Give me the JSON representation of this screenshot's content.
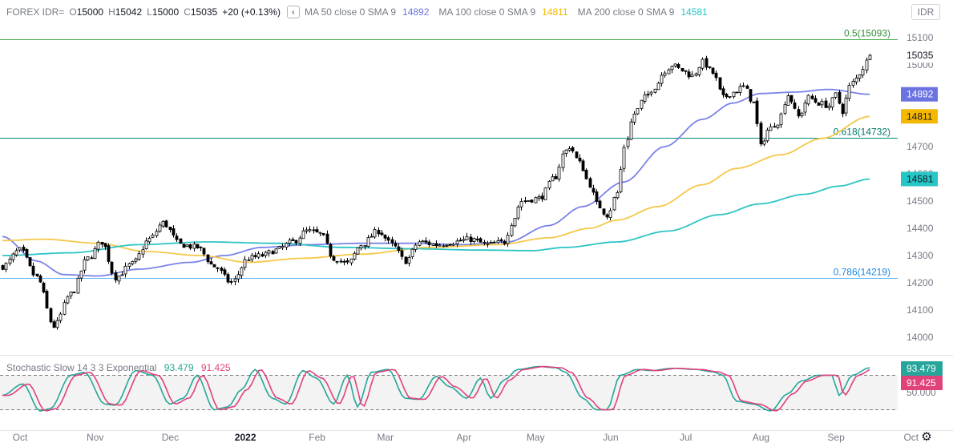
{
  "legend": {
    "symbol": "FOREX IDR=",
    "o_label": "O",
    "o_value": "15000",
    "h_label": "H",
    "h_value": "15042",
    "l_label": "L",
    "l_value": "15000",
    "c_label": "C",
    "c_value": "15035",
    "change": "+20 (+0.13%)",
    "collapse_icon": "chevron-left-icon",
    "ma": [
      {
        "label": "MA 50 close 0 SMA 9",
        "value": "14892",
        "color": "#7b83e8"
      },
      {
        "label": "MA 100 close 0 SMA 9",
        "value": "14811",
        "color": "#f5b800"
      },
      {
        "label": "MA 200 close 0 SMA 9",
        "value": "14581",
        "color": "#26c6c6"
      }
    ]
  },
  "currency_button": "IDR",
  "oscillator": {
    "label": "Stochastic Slow 14 3 3 Exponential",
    "k_value": "93.479",
    "k_color": "#26a69a",
    "d_value": "91.425",
    "d_color": "#e0427a",
    "axis_label": "50.000",
    "band_upper": 80,
    "band_lower": 20
  },
  "price_badges": [
    {
      "text": "15035",
      "value": 15035,
      "style": "plain"
    },
    {
      "text": "14892",
      "value": 14892,
      "bg": "#6b73e0",
      "fg": "#ffffff"
    },
    {
      "text": "14811",
      "value": 14811,
      "bg": "#f5b800",
      "fg": "#131722"
    },
    {
      "text": "14581",
      "value": 14581,
      "bg": "#26c6c6",
      "fg": "#131722"
    }
  ],
  "osc_badges": [
    {
      "text": "93.479",
      "bg": "#26a69a",
      "fg": "#ffffff"
    },
    {
      "text": "91.425",
      "bg": "#e0427a",
      "fg": "#ffffff"
    }
  ],
  "settings_icon": "gear-icon",
  "chart_data": {
    "type": "candlestick",
    "y_range": [
      13950,
      15150
    ],
    "y_ticks": [
      14000,
      14100,
      14200,
      14300,
      14400,
      14500,
      14600,
      14700,
      14800,
      14900,
      15000,
      15100
    ],
    "x_labels": [
      "Oct",
      "Nov",
      "Dec",
      "2022",
      "Feb",
      "Mar",
      "Apr",
      "May",
      "Jun",
      "Jul",
      "Aug",
      "Sep",
      "Oct"
    ],
    "x_month_starts": [
      0,
      22,
      44,
      66,
      87,
      107,
      130,
      151,
      173,
      195,
      217,
      239,
      261
    ],
    "fib_levels": [
      {
        "label": "0.5(15093)",
        "value": 15093,
        "color": "#4caf50",
        "text_color": "#388e3c"
      },
      {
        "label": "0.618(14732)",
        "value": 14732,
        "color": "#00897b",
        "text_color": "#00796b"
      },
      {
        "label": "0.786(14219)",
        "value": 14219,
        "color": "#64b5f6",
        "text_color": "#1e88e5"
      }
    ],
    "last_close": 15035,
    "price_anchors": [
      [
        0,
        14260
      ],
      [
        5,
        14320
      ],
      [
        10,
        14220
      ],
      [
        15,
        14040
      ],
      [
        20,
        14160
      ],
      [
        25,
        14290
      ],
      [
        29,
        14350
      ],
      [
        33,
        14220
      ],
      [
        38,
        14270
      ],
      [
        43,
        14360
      ],
      [
        47,
        14420
      ],
      [
        52,
        14340
      ],
      [
        57,
        14330
      ],
      [
        62,
        14260
      ],
      [
        67,
        14200
      ],
      [
        72,
        14290
      ],
      [
        76,
        14300
      ],
      [
        80,
        14320
      ],
      [
        85,
        14350
      ],
      [
        89,
        14390
      ],
      [
        93,
        14380
      ],
      [
        97,
        14290
      ],
      [
        101,
        14270
      ],
      [
        105,
        14340
      ],
      [
        110,
        14390
      ],
      [
        114,
        14340
      ],
      [
        118,
        14280
      ],
      [
        122,
        14350
      ],
      [
        127,
        14340
      ],
      [
        132,
        14350
      ],
      [
        137,
        14360
      ],
      [
        142,
        14340
      ],
      [
        147,
        14350
      ],
      [
        149,
        14420
      ],
      [
        152,
        14500
      ],
      [
        157,
        14510
      ],
      [
        162,
        14590
      ],
      [
        164,
        14670
      ],
      [
        166,
        14700
      ],
      [
        169,
        14640
      ],
      [
        172,
        14560
      ],
      [
        174,
        14490
      ],
      [
        177,
        14450
      ],
      [
        180,
        14530
      ],
      [
        182,
        14700
      ],
      [
        185,
        14820
      ],
      [
        188,
        14880
      ],
      [
        191,
        14920
      ],
      [
        194,
        14980
      ],
      [
        196,
        15000
      ],
      [
        199,
        14980
      ],
      [
        202,
        14960
      ],
      [
        205,
        15010
      ],
      [
        208,
        14970
      ],
      [
        211,
        14880
      ],
      [
        214,
        14900
      ],
      [
        217,
        14920
      ],
      [
        220,
        14860
      ],
      [
        222,
        14700
      ],
      [
        224,
        14760
      ],
      [
        227,
        14790
      ],
      [
        230,
        14890
      ],
      [
        233,
        14810
      ],
      [
        236,
        14880
      ],
      [
        239,
        14860
      ],
      [
        242,
        14850
      ],
      [
        244,
        14890
      ],
      [
        246,
        14830
      ],
      [
        248,
        14920
      ],
      [
        250,
        14950
      ],
      [
        252,
        14990
      ],
      [
        254,
        15035
      ]
    ],
    "candle_count": 255,
    "ma_series": [
      {
        "name": "MA 50",
        "color": "#7b83e8",
        "width": 1.8,
        "points": [
          [
            0,
            14370
          ],
          [
            10,
            14280
          ],
          [
            18,
            14230
          ],
          [
            28,
            14225
          ],
          [
            40,
            14250
          ],
          [
            55,
            14275
          ],
          [
            65,
            14300
          ],
          [
            76,
            14330
          ],
          [
            90,
            14340
          ],
          [
            105,
            14345
          ],
          [
            120,
            14345
          ],
          [
            135,
            14340
          ],
          [
            148,
            14350
          ],
          [
            160,
            14410
          ],
          [
            170,
            14480
          ],
          [
            182,
            14570
          ],
          [
            194,
            14700
          ],
          [
            205,
            14800
          ],
          [
            214,
            14860
          ],
          [
            222,
            14895
          ],
          [
            232,
            14900
          ],
          [
            242,
            14910
          ],
          [
            254,
            14892
          ]
        ]
      },
      {
        "name": "MA 100",
        "color": "#f5c84a",
        "width": 1.8,
        "points": [
          [
            0,
            14355
          ],
          [
            12,
            14360
          ],
          [
            28,
            14345
          ],
          [
            42,
            14315
          ],
          [
            58,
            14300
          ],
          [
            72,
            14275
          ],
          [
            88,
            14290
          ],
          [
            105,
            14305
          ],
          [
            125,
            14330
          ],
          [
            145,
            14340
          ],
          [
            160,
            14365
          ],
          [
            172,
            14400
          ],
          [
            180,
            14430
          ],
          [
            192,
            14480
          ],
          [
            205,
            14560
          ],
          [
            215,
            14620
          ],
          [
            228,
            14670
          ],
          [
            240,
            14730
          ],
          [
            254,
            14811
          ]
        ]
      },
      {
        "name": "MA 200",
        "color": "#2ec4c4",
        "width": 1.8,
        "points": [
          [
            0,
            14300
          ],
          [
            20,
            14310
          ],
          [
            40,
            14340
          ],
          [
            60,
            14350
          ],
          [
            80,
            14345
          ],
          [
            100,
            14330
          ],
          [
            120,
            14325
          ],
          [
            140,
            14320
          ],
          [
            155,
            14318
          ],
          [
            165,
            14330
          ],
          [
            180,
            14350
          ],
          [
            195,
            14390
          ],
          [
            210,
            14450
          ],
          [
            222,
            14490
          ],
          [
            235,
            14525
          ],
          [
            245,
            14555
          ],
          [
            254,
            14581
          ]
        ]
      }
    ],
    "stoch_anchors": [
      [
        0,
        45
      ],
      [
        6,
        65
      ],
      [
        11,
        18
      ],
      [
        14,
        22
      ],
      [
        20,
        80
      ],
      [
        24,
        85
      ],
      [
        30,
        30
      ],
      [
        33,
        28
      ],
      [
        39,
        88
      ],
      [
        44,
        80
      ],
      [
        49,
        30
      ],
      [
        53,
        40
      ],
      [
        57,
        80
      ],
      [
        62,
        20
      ],
      [
        66,
        25
      ],
      [
        70,
        55
      ],
      [
        74,
        90
      ],
      [
        79,
        40
      ],
      [
        83,
        30
      ],
      [
        88,
        88
      ],
      [
        92,
        75
      ],
      [
        97,
        30
      ],
      [
        101,
        80
      ],
      [
        104,
        25
      ],
      [
        108,
        85
      ],
      [
        113,
        90
      ],
      [
        118,
        40
      ],
      [
        122,
        38
      ],
      [
        127,
        78
      ],
      [
        131,
        60
      ],
      [
        136,
        40
      ],
      [
        140,
        75
      ],
      [
        143,
        40
      ],
      [
        147,
        72
      ],
      [
        151,
        90
      ],
      [
        157,
        95
      ],
      [
        162,
        93
      ],
      [
        165,
        85
      ],
      [
        170,
        40
      ],
      [
        174,
        20
      ],
      [
        177,
        20
      ],
      [
        181,
        80
      ],
      [
        186,
        90
      ],
      [
        190,
        88
      ],
      [
        196,
        92
      ],
      [
        203,
        90
      ],
      [
        208,
        86
      ],
      [
        211,
        80
      ],
      [
        215,
        35
      ],
      [
        220,
        30
      ],
      [
        225,
        18
      ],
      [
        230,
        48
      ],
      [
        234,
        70
      ],
      [
        239,
        80
      ],
      [
        243,
        80
      ],
      [
        245,
        45
      ],
      [
        249,
        80
      ],
      [
        254,
        93
      ]
    ]
  }
}
